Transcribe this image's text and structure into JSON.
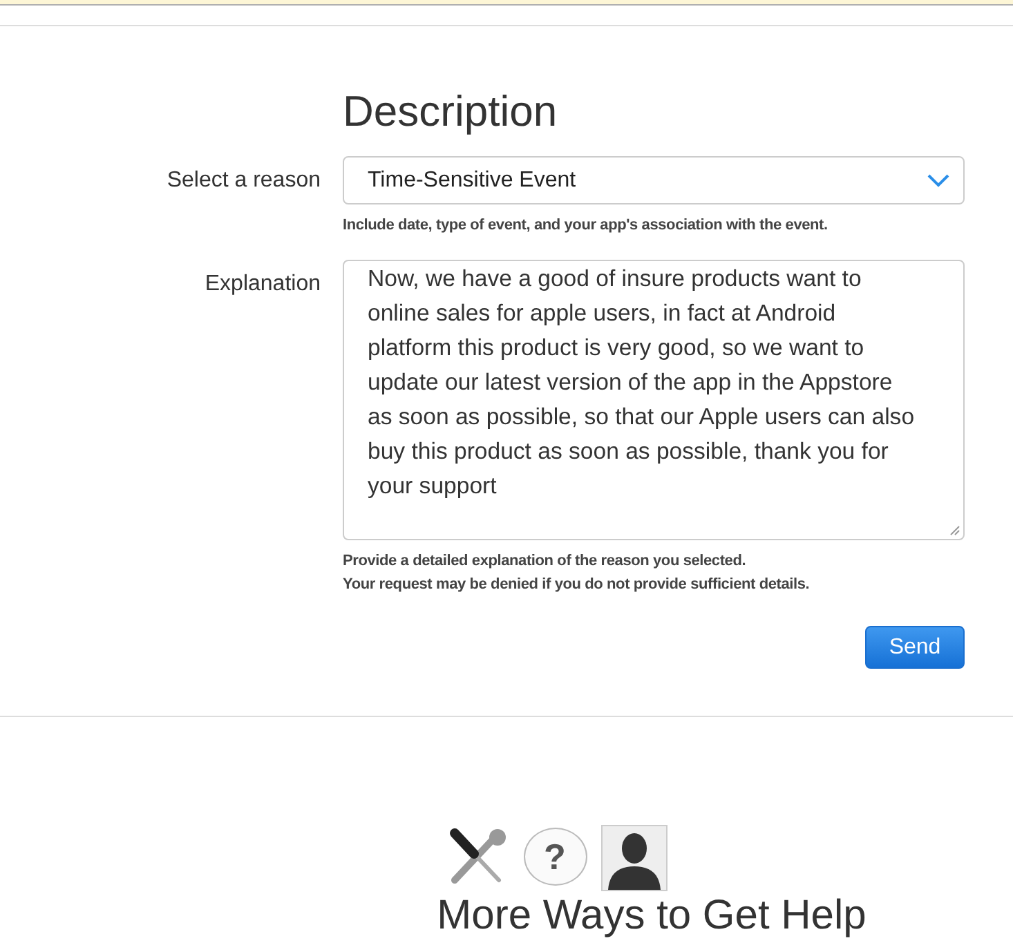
{
  "form": {
    "title": "Description",
    "reason": {
      "label": "Select a reason",
      "value": "Time-Sensitive Event",
      "hint": "Include date, type of event, and your app's association with the event."
    },
    "explanation": {
      "label": "Explanation",
      "value": "Now, we have a good of insure products want to online sales for apple users, in fact at Android platform this product is very good, so we want to update our latest version of the app in the Appstore as soon as possible, so that our Apple users can also buy this product as soon as possible, thank you for your support",
      "hints": [
        "Provide a detailed explanation of the reason you selected.",
        "Your request may be denied if you do not provide sufficient details."
      ]
    },
    "send_button": "Send"
  },
  "more_help": {
    "icons": [
      {
        "kind": "tools"
      },
      {
        "kind": "question",
        "glyph": "?"
      },
      {
        "kind": "person"
      }
    ],
    "title": "More Ways to Get Help"
  }
}
